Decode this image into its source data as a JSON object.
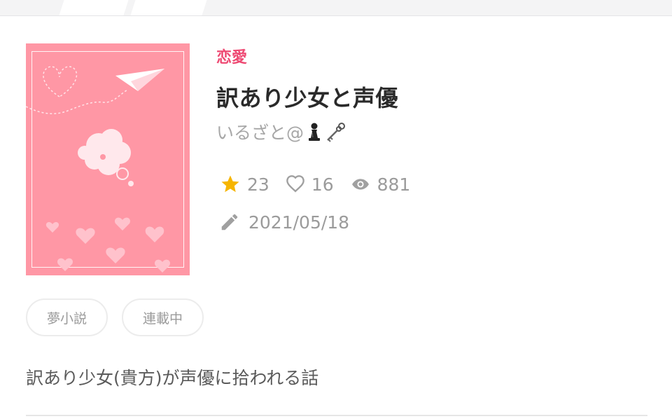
{
  "colors": {
    "accent": "#ee4a73",
    "cover_bg": "#ff97a5",
    "star": "#f6b500",
    "muted": "#9b9b9b"
  },
  "book": {
    "genre": "恋愛",
    "title": "訳あり少女と声優",
    "author": "いるざと@",
    "author_icons": [
      "chess-pawn-icon",
      "key-icon"
    ],
    "stats": {
      "stars": "23",
      "likes": "16",
      "views": "881"
    },
    "updated": "2021/05/18",
    "tags": [
      "夢小説",
      "連載中"
    ],
    "summary": "訳あり少女(貴方)が声優に拾われる話"
  }
}
